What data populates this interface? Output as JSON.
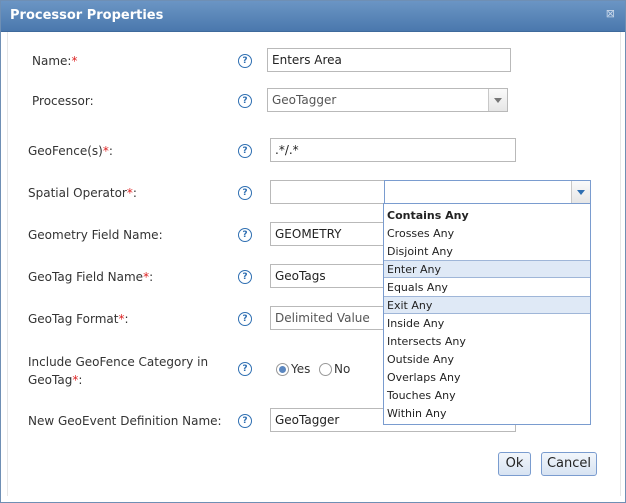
{
  "dialog": {
    "title": "Processor Properties",
    "close_glyph": "⊠"
  },
  "fields": {
    "name": {
      "label": "Name:",
      "required": "*",
      "value": "Enters Area"
    },
    "processor": {
      "label": "Processor:",
      "value": "GeoTagger"
    },
    "geofences": {
      "label": "GeoFence(s)",
      "required": "*",
      "suffix": ":",
      "value": ".*/.*"
    },
    "spatial_operator": {
      "label": "Spatial Operator",
      "required": "*",
      "suffix": ":",
      "value": ""
    },
    "geometry_field": {
      "label": "Geometry Field Name:",
      "value": "GEOMETRY"
    },
    "geotag_field": {
      "label": "GeoTag Field Name",
      "required": "*",
      "suffix": ":",
      "value": "GeoTags"
    },
    "geotag_format": {
      "label": "GeoTag Format",
      "required": "*",
      "suffix": ":",
      "value": "Delimited Value"
    },
    "include_category": {
      "label_line1": "Include GeoFence Category in",
      "label_line2": "GeoTag",
      "required": "*",
      "suffix": ":",
      "yes": "Yes",
      "no": "No",
      "selected": "Yes"
    },
    "new_definition": {
      "label": "New GeoEvent Definition Name:",
      "value": "GeoTagger"
    }
  },
  "help_glyph": "?",
  "spatial_options": [
    "Contains Any",
    "Crosses Any",
    "Disjoint Any",
    "Enter Any",
    "Equals Any",
    "Exit Any",
    "Inside Any",
    "Intersects Any",
    "Outside Any",
    "Overlaps Any",
    "Touches Any",
    "Within Any"
  ],
  "buttons": {
    "ok": "Ok",
    "cancel": "Cancel"
  }
}
